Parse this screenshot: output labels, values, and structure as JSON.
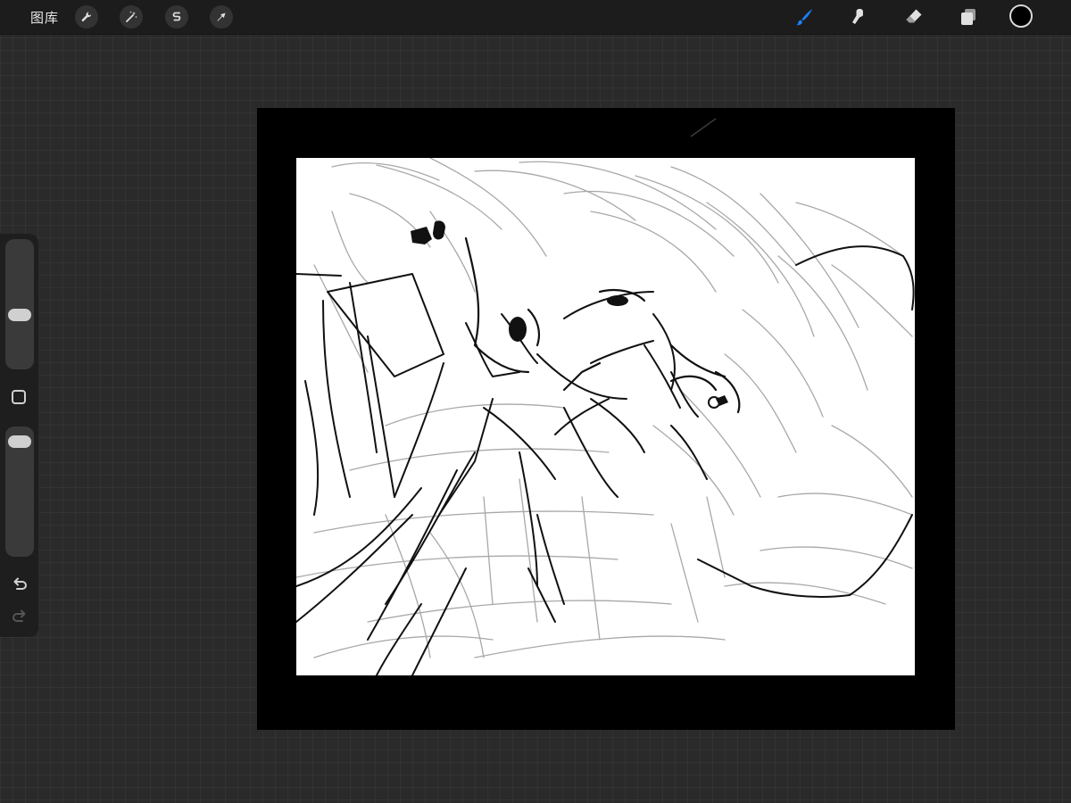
{
  "topbar": {
    "gallery_label": "图库",
    "tools_left": [
      {
        "name": "actions",
        "icon": "wrench-icon"
      },
      {
        "name": "adjustments",
        "icon": "magic-wand-icon"
      },
      {
        "name": "selection",
        "icon": "selection-s-icon"
      },
      {
        "name": "transform",
        "icon": "arrow-cursor-icon"
      }
    ],
    "tools_right": [
      {
        "name": "brush",
        "icon": "brush-icon",
        "active": true
      },
      {
        "name": "smudge",
        "icon": "smudge-icon",
        "active": false
      },
      {
        "name": "eraser",
        "icon": "eraser-icon",
        "active": false
      },
      {
        "name": "layers",
        "icon": "layers-icon",
        "active": false
      }
    ],
    "current_color": "#000000"
  },
  "sidebar": {
    "brush_size": 0.4,
    "brush_opacity": 0.95
  },
  "colors": {
    "accent": "#1a82ff",
    "toolbar_bg": "#1c1c1c",
    "workspace_bg": "#2a2a2a",
    "canvas_border": "#000000",
    "artboard_bg": "#ffffff"
  }
}
